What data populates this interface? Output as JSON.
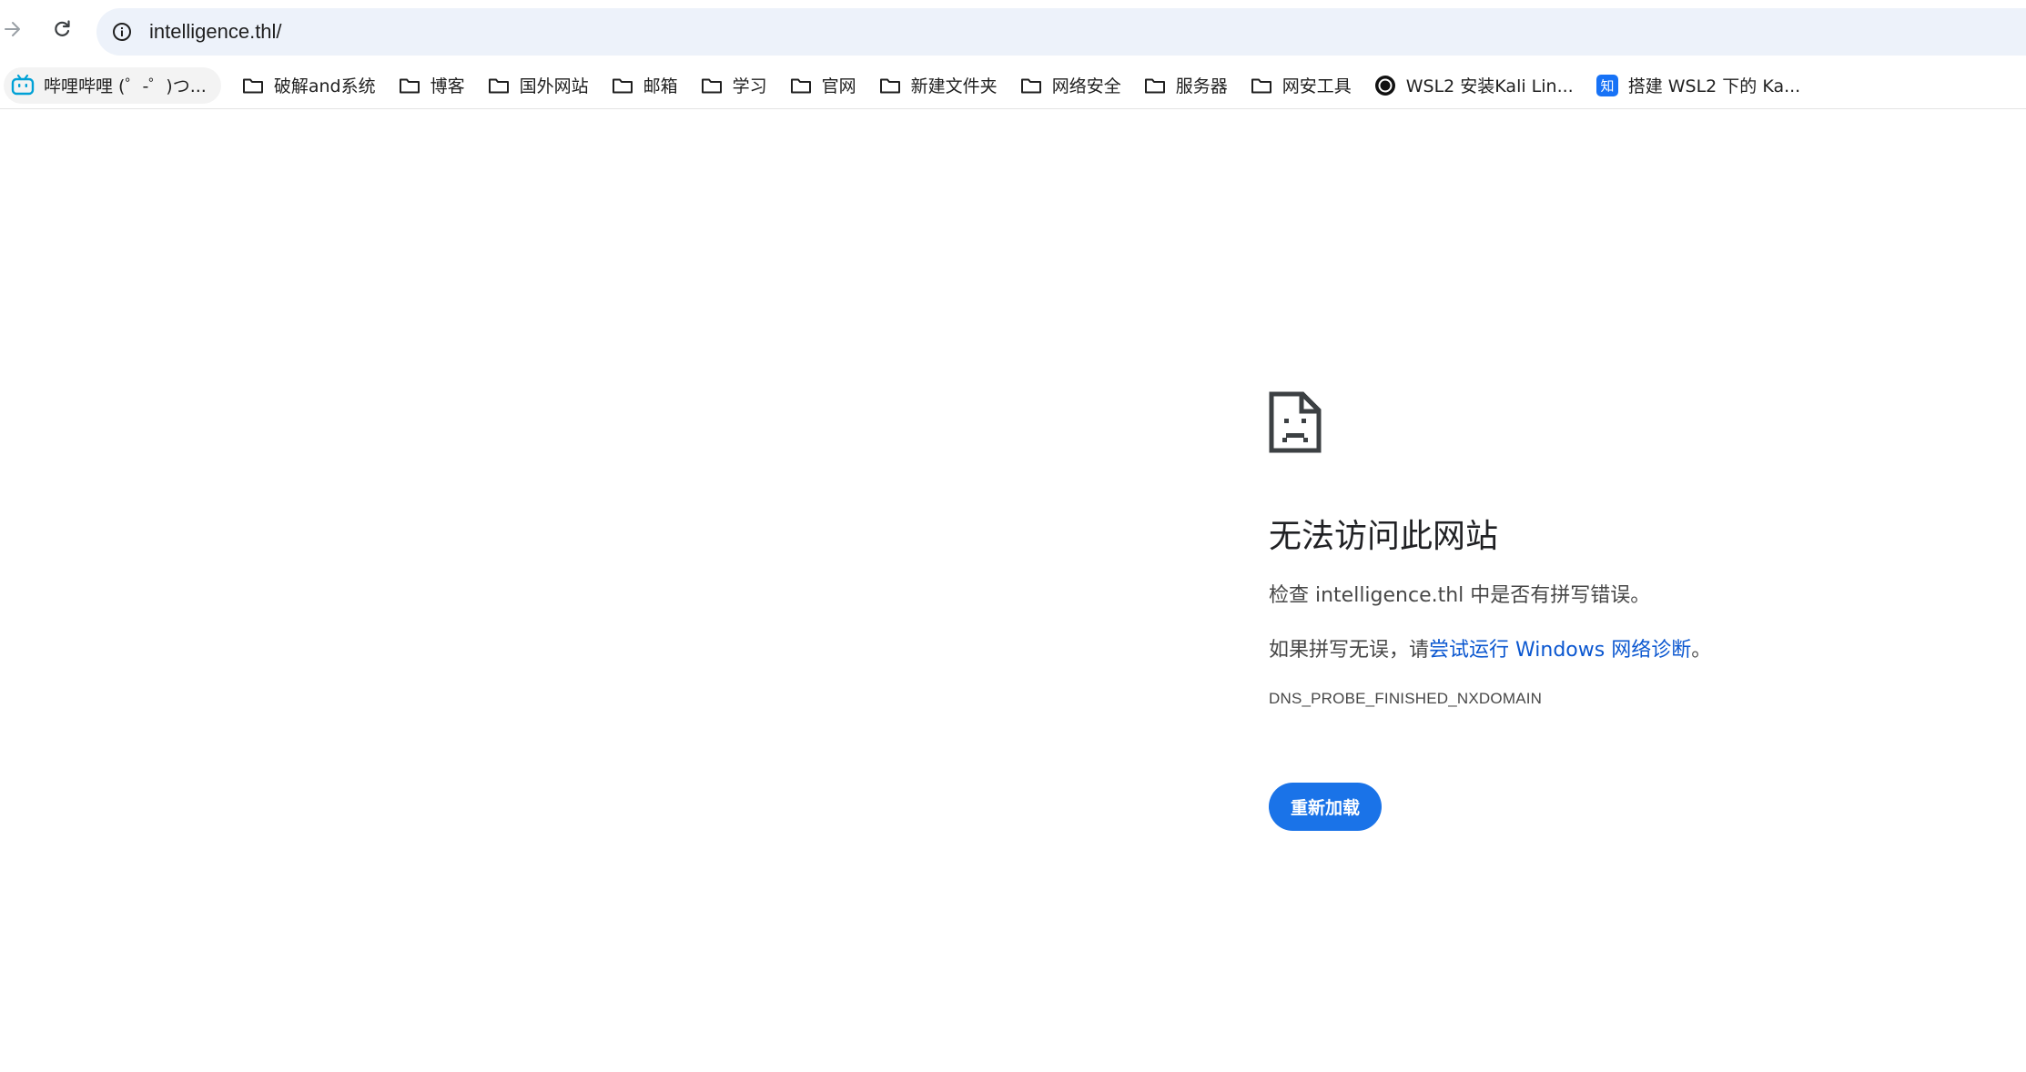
{
  "toolbar": {
    "forward_icon": "arrow-right-icon",
    "reload_icon": "reload-icon",
    "site_info_icon": "info-icon",
    "url": "intelligence.thl/"
  },
  "bookmarks": [
    {
      "icon": "bilibili-icon",
      "label": "哔哩哔哩 (゜-゜)つ..."
    },
    {
      "icon": "folder-icon",
      "label": "破解and系统"
    },
    {
      "icon": "folder-icon",
      "label": "博客"
    },
    {
      "icon": "folder-icon",
      "label": "国外网站"
    },
    {
      "icon": "folder-icon",
      "label": "邮箱"
    },
    {
      "icon": "folder-icon",
      "label": "学习"
    },
    {
      "icon": "folder-icon",
      "label": "官网"
    },
    {
      "icon": "folder-icon",
      "label": "新建文件夹"
    },
    {
      "icon": "folder-icon",
      "label": "网络安全"
    },
    {
      "icon": "folder-icon",
      "label": "服务器"
    },
    {
      "icon": "folder-icon",
      "label": "网安工具"
    },
    {
      "icon": "circle-site-icon",
      "label": "WSL2 安装Kali Lin..."
    },
    {
      "icon": "zhihu-icon",
      "label": "搭建 WSL2 下的 Ka..."
    }
  ],
  "error": {
    "icon": "sad-page-icon",
    "title": "无法访问此网站",
    "line1": "检查 intelligence.thl 中是否有拼写错误。",
    "line2_prefix": "如果拼写无误，请",
    "line2_link": "尝试运行 Windows 网络诊断",
    "line2_suffix": "。",
    "code": "DNS_PROBE_FINISHED_NXDOMAIN",
    "reload_label": "重新加载"
  },
  "colors": {
    "accent": "#1a73e8",
    "link": "#0b57d0",
    "omnibox_bg": "#edf2fa",
    "bilibili": "#00a1d6",
    "zhihu": "#1772f6"
  }
}
